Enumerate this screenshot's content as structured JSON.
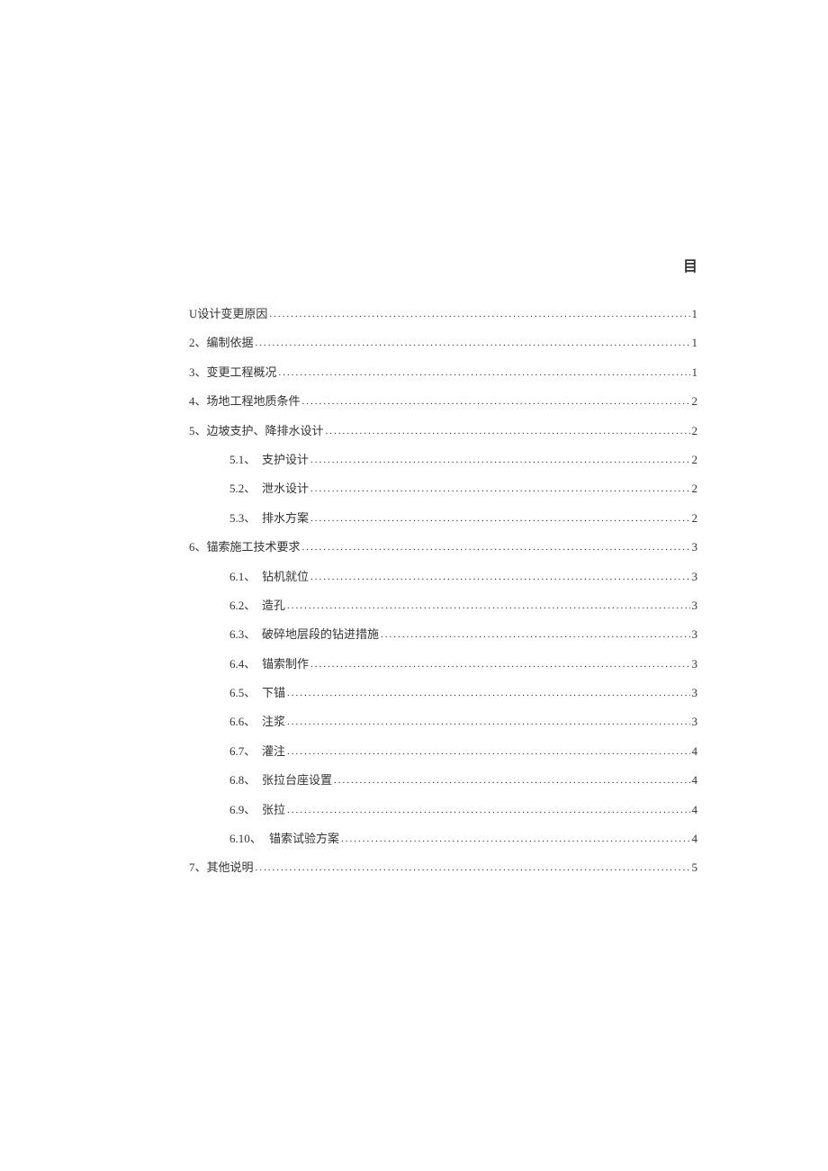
{
  "header": "目",
  "toc": [
    {
      "num": "U",
      "title": "设计变更原因",
      "page": "1",
      "level": 1
    },
    {
      "num": "2、",
      "title": "编制依据",
      "page": "1",
      "level": 1
    },
    {
      "num": "3、",
      "title": "变更工程概况",
      "page": "1",
      "level": 1
    },
    {
      "num": "4、",
      "title": "场地工程地质条件",
      "page": "2",
      "level": 1
    },
    {
      "num": "5、",
      "title": "边坡支护、降排水设计",
      "page": "2",
      "level": 1
    },
    {
      "num": "5.1、",
      "title": "支护设计",
      "page": "2",
      "level": 2
    },
    {
      "num": "5.2、",
      "title": "泄水设计",
      "page": "2",
      "level": 2
    },
    {
      "num": "5.3、",
      "title": "排水方案",
      "page": "2",
      "level": 2
    },
    {
      "num": "6、",
      "title": "锚索施工技术要求",
      "page": "3",
      "level": 1
    },
    {
      "num": "6.1、",
      "title": "钻机就位",
      "page": "3",
      "level": 2
    },
    {
      "num": "6.2、",
      "title": "造孔",
      "page": "3",
      "level": 2
    },
    {
      "num": "6.3、",
      "title": "破碎地层段的钻进措施",
      "page": "3",
      "level": 2
    },
    {
      "num": "6.4、",
      "title": "锚索制作",
      "page": "3",
      "level": 2
    },
    {
      "num": "6.5、",
      "title": "下锚",
      "page": "3",
      "level": 2
    },
    {
      "num": "6.6、",
      "title": "注浆",
      "page": "3",
      "level": 2
    },
    {
      "num": "6.7、",
      "title": "灌注",
      "page": "4",
      "level": 2
    },
    {
      "num": "6.8、",
      "title": "张拉台座设置",
      "page": "4",
      "level": 2
    },
    {
      "num": "6.9、",
      "title": "张拉",
      "page": "4",
      "level": 2
    },
    {
      "num": "6.10、",
      "title": "锚索试验方案",
      "page": "4",
      "level": 2
    },
    {
      "num": "7、",
      "title": "其他说明",
      "page": "5",
      "level": 1
    }
  ]
}
